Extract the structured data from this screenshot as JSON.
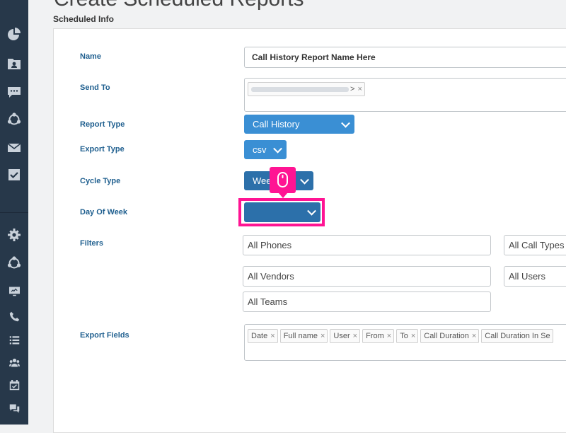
{
  "page": {
    "title": "Create Scheduled Reports",
    "section": "Scheduled Info"
  },
  "sidebar": {
    "icons": [
      "pie-chart-icon",
      "contacts-folder-icon",
      "chat-icon",
      "network-icon",
      "mail-icon",
      "check-square-icon",
      "gear-icon",
      "network-icon",
      "monitor-icon",
      "phone-icon",
      "list-icon",
      "users-icon",
      "calendar-check-icon",
      "chat-bubbles-icon"
    ]
  },
  "form": {
    "name": {
      "label": "Name",
      "value": "Call History Report Name Here"
    },
    "send_to": {
      "label": "Send To",
      "tag_suffix": ">",
      "remove": "×"
    },
    "report_type": {
      "label": "Report Type",
      "value": "Call History"
    },
    "export_type": {
      "label": "Export Type",
      "value": "csv"
    },
    "cycle_type": {
      "label": "Cycle Type",
      "value": "Weekly",
      "visible_value": "Wee"
    },
    "day_of_week": {
      "label": "Day Of Week",
      "value": ""
    },
    "filters": {
      "label": "Filters",
      "phones": "All Phones",
      "call_types": "All Call Types",
      "vendors": "All Vendors",
      "users": "All Users",
      "teams": "All Teams"
    },
    "export_fields": {
      "label": "Export Fields",
      "tags": [
        "Date",
        "Full name",
        "User",
        "From",
        "To",
        "Call Duration",
        "Call Duration In Se"
      ]
    }
  },
  "overlay": {
    "highlight_color": "#ff1493",
    "cursor_icon": "mouse-icon"
  }
}
